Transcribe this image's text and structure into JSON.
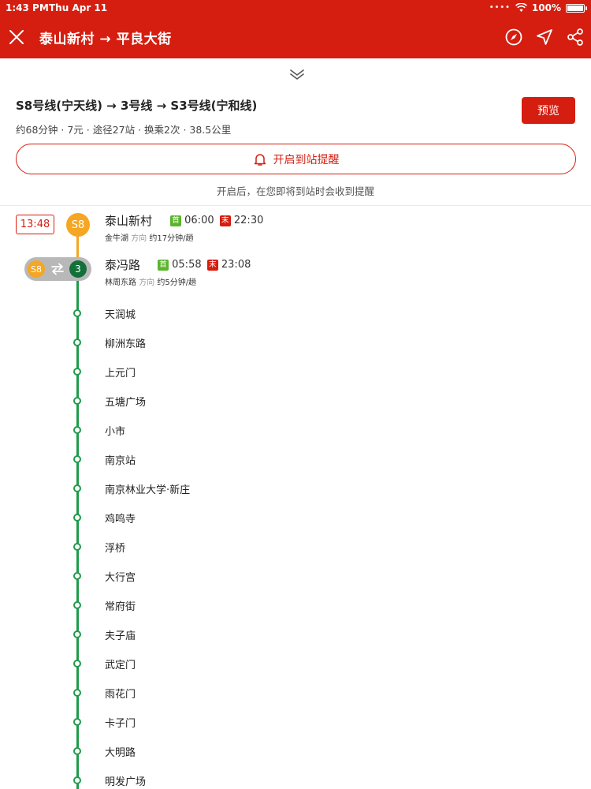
{
  "status_bar": {
    "time": "1:43 PM",
    "date": "Thu Apr 11",
    "battery": "100%"
  },
  "header": {
    "title": "泰山新村 → 平良大街"
  },
  "summary": {
    "lines": "S8号线(宁天线) → 3号线 → S3号线(宁和线)",
    "meta": "约68分钟 · 7元 · 途径27站 · 换乘2次 · 38.5公里",
    "preview_label": "预览",
    "alert_label": "开启到站提醒",
    "alert_hint": "开启后，在您即将到站时会收到提醒"
  },
  "timeline": {
    "depart_time": "13:48",
    "start": {
      "badge": "S8",
      "name": "泰山新村",
      "first_tag": "首",
      "first_time": "06:00",
      "last_tag": "末",
      "last_time": "22:30",
      "direction_station": "金牛湖",
      "direction_label": "方向",
      "frequency": "约17分钟/趟"
    },
    "transfer": {
      "from_badge": "S8",
      "to_badge": "3",
      "name": "泰冯路",
      "first_tag": "首",
      "first_time": "05:58",
      "last_tag": "末",
      "last_time": "23:08",
      "direction_station": "林周东路",
      "direction_label": "方向",
      "frequency": "约5分钟/趟"
    },
    "stops": [
      "天润城",
      "柳洲东路",
      "上元门",
      "五塘广场",
      "小市",
      "南京站",
      "南京林业大学·新庄",
      "鸡鸣寺",
      "浮桥",
      "大行宫",
      "常府街",
      "夫子庙",
      "武定门",
      "雨花门",
      "卡子门",
      "大明路",
      "明发广场"
    ]
  },
  "colors": {
    "brand_red": "#d51e10",
    "s8_yellow": "#f5a623",
    "line3_green": "#1f9b4a"
  }
}
